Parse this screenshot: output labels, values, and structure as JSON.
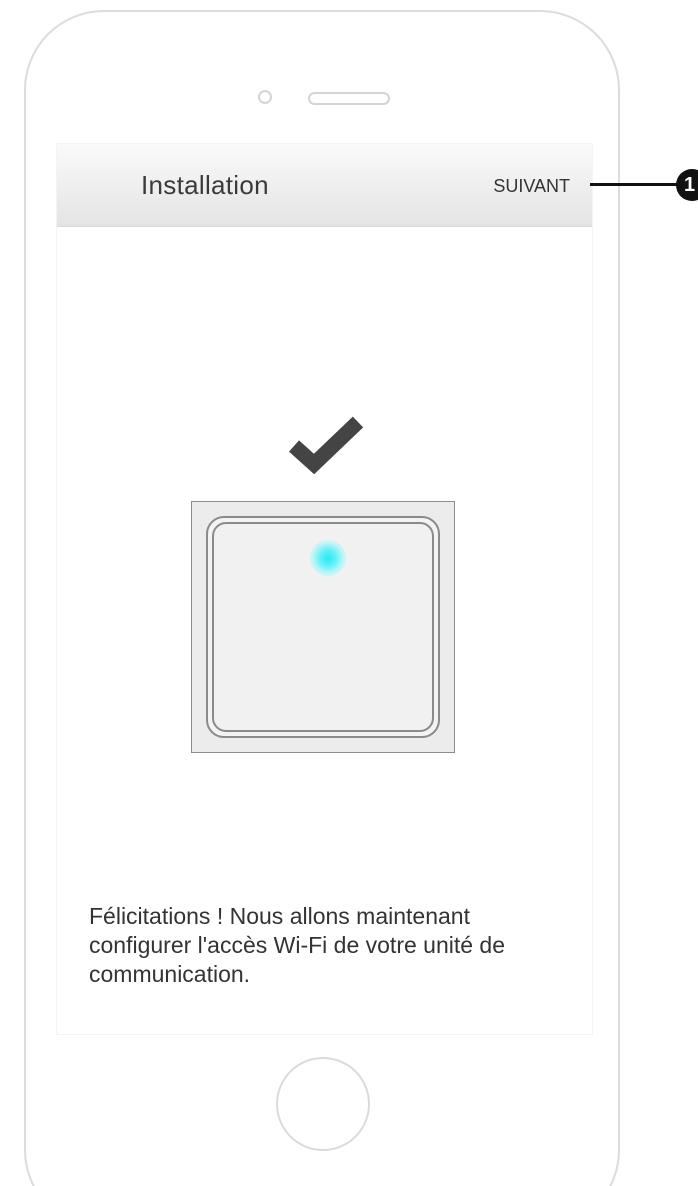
{
  "header": {
    "title": "Installation",
    "next_label": "SUIVANT"
  },
  "illustration": {
    "status_icon": "checkmark-icon",
    "device": "communication-unit",
    "led_color": "#26e8f4"
  },
  "message": "Félicitations ! Nous allons maintenant configurer l'accès Wi-Fi de votre unité de communication.",
  "callout": {
    "number": "1"
  },
  "colors": {
    "header_top": "#fafafa",
    "header_bottom": "#e4e4e4",
    "text": "#333333",
    "check": "#444444"
  }
}
